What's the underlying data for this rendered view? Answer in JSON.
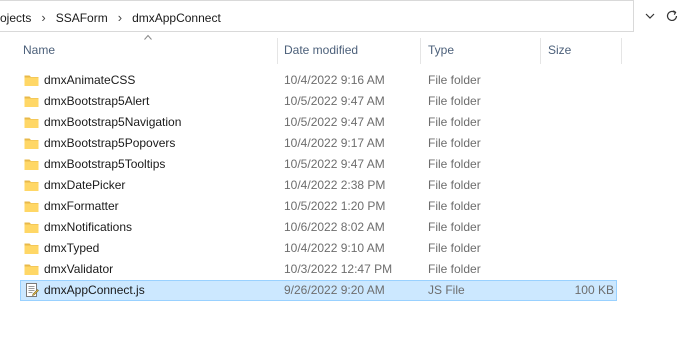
{
  "address": {
    "crumbs": [
      "ojects",
      "SSAForm",
      "dmxAppConnect"
    ],
    "separator": "›"
  },
  "columns": {
    "name": "Name",
    "date": "Date modified",
    "type": "Type",
    "size": "Size"
  },
  "files": [
    {
      "name": "dmxAnimateCSS",
      "date": "10/4/2022 9:16 AM",
      "type": "File folder",
      "size": "",
      "icon": "folder-icon"
    },
    {
      "name": "dmxBootstrap5Alert",
      "date": "10/5/2022 9:47 AM",
      "type": "File folder",
      "size": "",
      "icon": "folder-icon"
    },
    {
      "name": "dmxBootstrap5Navigation",
      "date": "10/5/2022 9:47 AM",
      "type": "File folder",
      "size": "",
      "icon": "folder-icon"
    },
    {
      "name": "dmxBootstrap5Popovers",
      "date": "10/4/2022 9:17 AM",
      "type": "File folder",
      "size": "",
      "icon": "folder-icon"
    },
    {
      "name": "dmxBootstrap5Tooltips",
      "date": "10/5/2022 9:47 AM",
      "type": "File folder",
      "size": "",
      "icon": "folder-icon"
    },
    {
      "name": "dmxDatePicker",
      "date": "10/4/2022 2:38 PM",
      "type": "File folder",
      "size": "",
      "icon": "folder-icon"
    },
    {
      "name": "dmxFormatter",
      "date": "10/5/2022 1:20 PM",
      "type": "File folder",
      "size": "",
      "icon": "folder-icon"
    },
    {
      "name": "dmxNotifications",
      "date": "10/6/2022 8:02 AM",
      "type": "File folder",
      "size": "",
      "icon": "folder-icon"
    },
    {
      "name": "dmxTyped",
      "date": "10/4/2022 9:10 AM",
      "type": "File folder",
      "size": "",
      "icon": "folder-icon"
    },
    {
      "name": "dmxValidator",
      "date": "10/3/2022 12:47 PM",
      "type": "File folder",
      "size": "",
      "icon": "folder-icon"
    },
    {
      "name": "dmxAppConnect.js",
      "date": "9/26/2022 9:20 AM",
      "type": "JS File",
      "size": "100 KB",
      "icon": "js-file-icon",
      "selected": true
    }
  ],
  "colors": {
    "selection": "#cce8ff",
    "selection_border": "#99d1ff",
    "folder": "#ffd766",
    "header_text": "#4c607a"
  }
}
